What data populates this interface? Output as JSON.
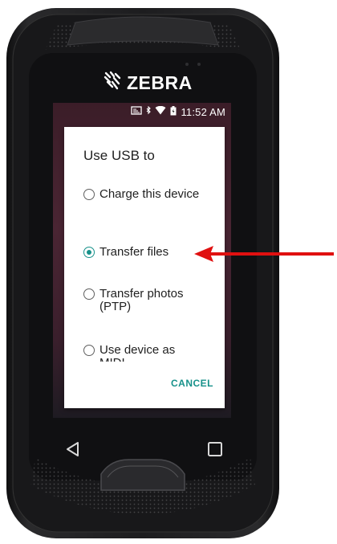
{
  "brand": {
    "name": "ZEBRA"
  },
  "statusbar": {
    "time": "11:52 AM"
  },
  "dialog": {
    "title": "Use USB to",
    "options": [
      {
        "label": "Charge this device",
        "selected": false
      },
      {
        "label": "Transfer files",
        "selected": true
      },
      {
        "label": "Transfer photos (PTP)",
        "selected": false
      },
      {
        "label": "Use device as MIDI",
        "selected": false
      }
    ],
    "cancel_label": "CANCEL"
  },
  "colors": {
    "accent": "#17918a",
    "annotation_arrow": "#e01010"
  },
  "icons": [
    "zebra-logo-icon",
    "cast-icon",
    "bluetooth-icon",
    "wifi-icon",
    "battery-icon",
    "back-icon",
    "recents-icon"
  ]
}
